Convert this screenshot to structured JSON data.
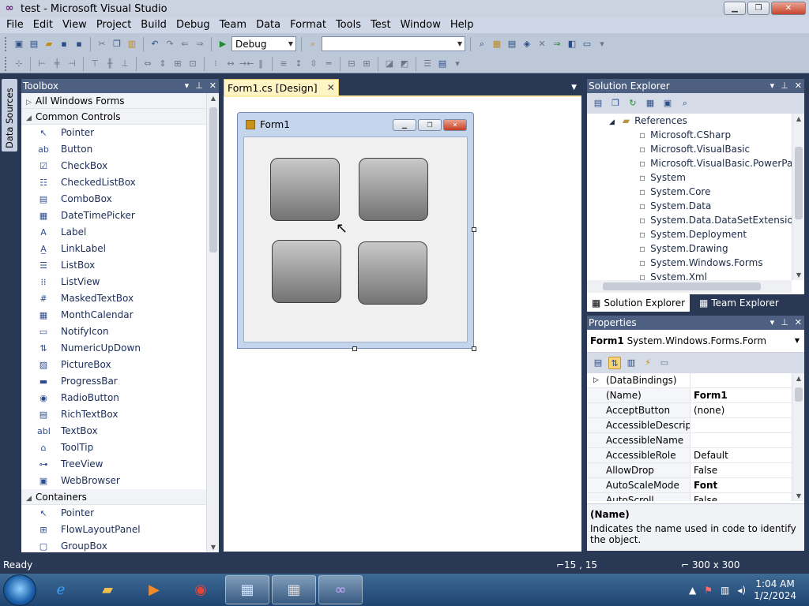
{
  "window": {
    "title": "test - Microsoft Visual Studio",
    "min": "▁",
    "max": "❐",
    "close": "✕"
  },
  "menu": [
    "File",
    "Edit",
    "View",
    "Project",
    "Build",
    "Debug",
    "Team",
    "Data",
    "Format",
    "Tools",
    "Test",
    "Window",
    "Help"
  ],
  "toolbar": {
    "config": "Debug",
    "platform": ""
  },
  "left_strip": {
    "tab": "Data Sources"
  },
  "toolbox": {
    "title": "Toolbox",
    "categories": [
      {
        "label": "All Windows Forms",
        "expanded": false,
        "items": []
      },
      {
        "label": "Common Controls",
        "expanded": true,
        "items": [
          {
            "label": "Pointer",
            "icon": "pointer-icon",
            "glyph": "↖"
          },
          {
            "label": "Button",
            "icon": "button-icon",
            "glyph": "ab"
          },
          {
            "label": "CheckBox",
            "icon": "checkbox-icon",
            "glyph": "☑"
          },
          {
            "label": "CheckedListBox",
            "icon": "checkedlistbox-icon",
            "glyph": "☷"
          },
          {
            "label": "ComboBox",
            "icon": "combobox-icon",
            "glyph": "▤"
          },
          {
            "label": "DateTimePicker",
            "icon": "datetimepicker-icon",
            "glyph": "▦"
          },
          {
            "label": "Label",
            "icon": "label-icon",
            "glyph": "A"
          },
          {
            "label": "LinkLabel",
            "icon": "linklabel-icon",
            "glyph": "A̲"
          },
          {
            "label": "ListBox",
            "icon": "listbox-icon",
            "glyph": "☰"
          },
          {
            "label": "ListView",
            "icon": "listview-icon",
            "glyph": "⁞⁞"
          },
          {
            "label": "MaskedTextBox",
            "icon": "maskedtextbox-icon",
            "glyph": "#"
          },
          {
            "label": "MonthCalendar",
            "icon": "monthcalendar-icon",
            "glyph": "▦"
          },
          {
            "label": "NotifyIcon",
            "icon": "notifyicon-icon",
            "glyph": "▭"
          },
          {
            "label": "NumericUpDown",
            "icon": "numericupdown-icon",
            "glyph": "⇅"
          },
          {
            "label": "PictureBox",
            "icon": "picturebox-icon",
            "glyph": "▨"
          },
          {
            "label": "ProgressBar",
            "icon": "progressbar-icon",
            "glyph": "▬"
          },
          {
            "label": "RadioButton",
            "icon": "radiobutton-icon",
            "glyph": "◉"
          },
          {
            "label": "RichTextBox",
            "icon": "richtextbox-icon",
            "glyph": "▤"
          },
          {
            "label": "TextBox",
            "icon": "textbox-icon",
            "glyph": "abl"
          },
          {
            "label": "ToolTip",
            "icon": "tooltip-icon",
            "glyph": "⌂"
          },
          {
            "label": "TreeView",
            "icon": "treeview-icon",
            "glyph": "⊶"
          },
          {
            "label": "WebBrowser",
            "icon": "webbrowser-icon",
            "glyph": "▣"
          }
        ]
      },
      {
        "label": "Containers",
        "expanded": true,
        "items": [
          {
            "label": "Pointer",
            "icon": "pointer-icon",
            "glyph": "↖"
          },
          {
            "label": "FlowLayoutPanel",
            "icon": "flowlayoutpanel-icon",
            "glyph": "⊞"
          },
          {
            "label": "GroupBox",
            "icon": "groupbox-icon",
            "glyph": "▢"
          }
        ]
      }
    ]
  },
  "document": {
    "tab": "Form1.cs [Design]",
    "form": {
      "title": "Form1"
    }
  },
  "solution_explorer": {
    "title": "Solution Explorer",
    "tree": [
      {
        "label": "References",
        "level": 1,
        "icon": "folder-icon"
      },
      {
        "label": "Microsoft.CSharp",
        "level": 2,
        "icon": "reference-icon"
      },
      {
        "label": "Microsoft.VisualBasic",
        "level": 2,
        "icon": "reference-icon"
      },
      {
        "label": "Microsoft.VisualBasic.PowerPacks",
        "level": 2,
        "icon": "reference-icon"
      },
      {
        "label": "System",
        "level": 2,
        "icon": "reference-icon"
      },
      {
        "label": "System.Core",
        "level": 2,
        "icon": "reference-icon"
      },
      {
        "label": "System.Data",
        "level": 2,
        "icon": "reference-icon"
      },
      {
        "label": "System.Data.DataSetExtensions",
        "level": 2,
        "icon": "reference-icon"
      },
      {
        "label": "System.Deployment",
        "level": 2,
        "icon": "reference-icon"
      },
      {
        "label": "System.Drawing",
        "level": 2,
        "icon": "reference-icon"
      },
      {
        "label": "System.Windows.Forms",
        "level": 2,
        "icon": "reference-icon"
      },
      {
        "label": "System.Xml",
        "level": 2,
        "icon": "reference-icon"
      }
    ],
    "tabs": [
      "Solution Explorer",
      "Team Explorer"
    ]
  },
  "properties": {
    "title": "Properties",
    "object_name": "Form1",
    "object_type": "System.Windows.Forms.Form",
    "rows": [
      {
        "name": "(DataBindings)",
        "value": "",
        "group": true
      },
      {
        "name": "(Name)",
        "value": "Form1",
        "bold": true
      },
      {
        "name": "AcceptButton",
        "value": "(none)"
      },
      {
        "name": "AccessibleDescription",
        "value": ""
      },
      {
        "name": "AccessibleName",
        "value": ""
      },
      {
        "name": "AccessibleRole",
        "value": "Default"
      },
      {
        "name": "AllowDrop",
        "value": "False"
      },
      {
        "name": "AutoScaleMode",
        "value": "Font",
        "bold": true
      },
      {
        "name": "AutoScroll",
        "value": "False"
      }
    ],
    "desc_title": "(Name)",
    "desc_text": "Indicates the name used in code to identify the object."
  },
  "status": {
    "text": "Ready",
    "position": "15 , 15",
    "size": "300 x 300"
  },
  "taskbar": {
    "time": "1:04 AM",
    "date": "1/2/2024"
  },
  "colors": {
    "ide_background": "#293955",
    "panel_header": "#4d6082",
    "tab_active": "#fff4c4"
  }
}
